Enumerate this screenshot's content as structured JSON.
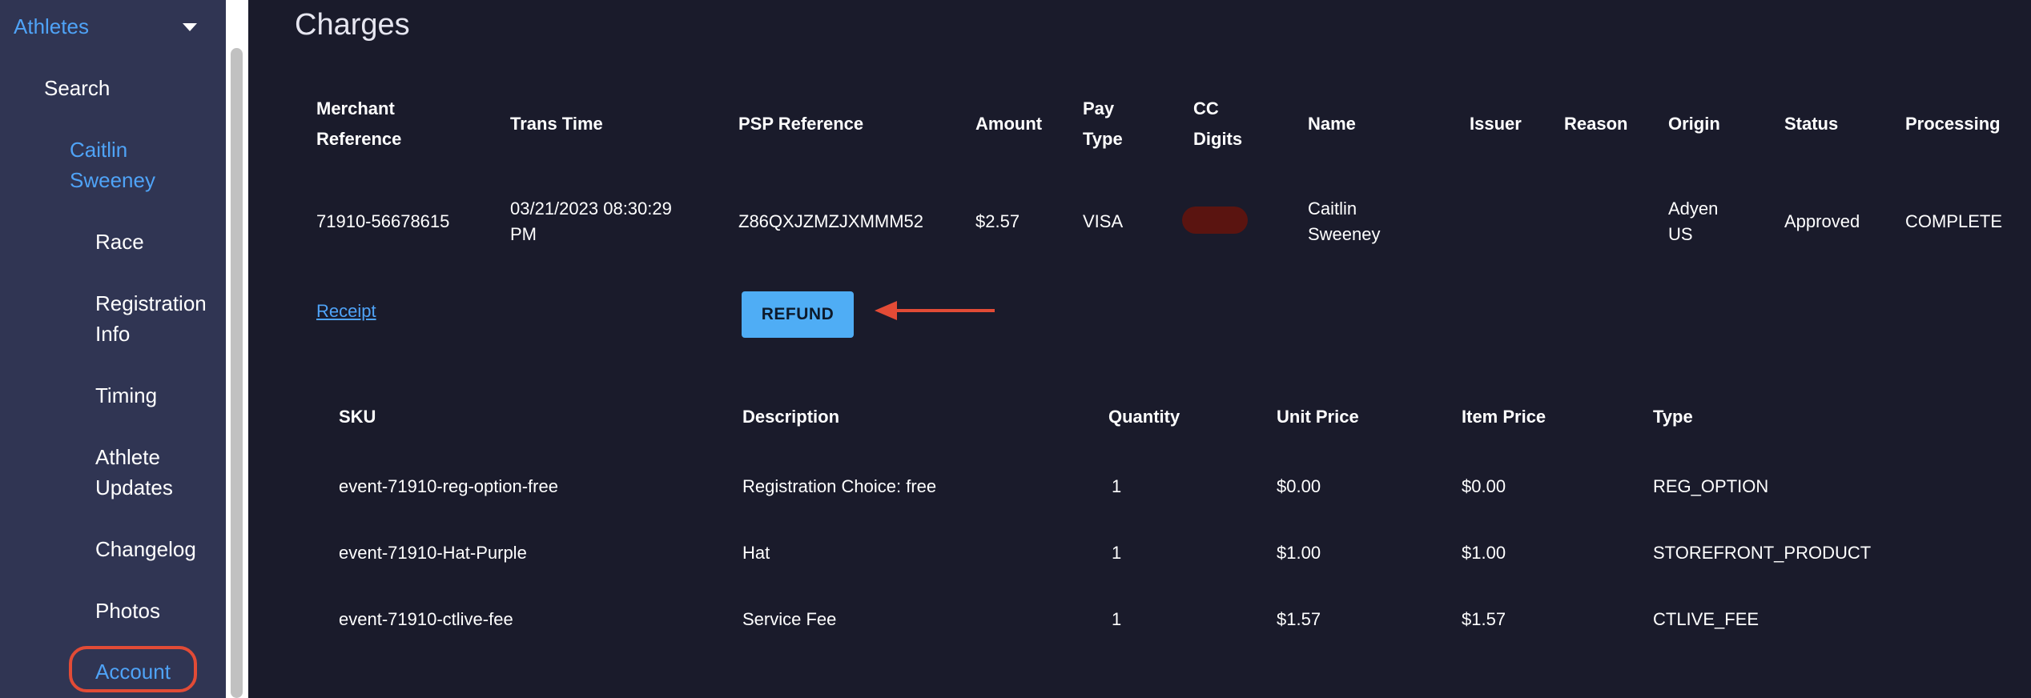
{
  "sidebar": {
    "section_label": "Athletes",
    "items": [
      {
        "label": "Search"
      },
      {
        "label": "Caitlin Sweeney"
      },
      {
        "label": "Race"
      },
      {
        "label": "Registration Info"
      },
      {
        "label": "Timing"
      },
      {
        "label": "Athlete Updates"
      },
      {
        "label": "Changelog"
      },
      {
        "label": "Photos"
      },
      {
        "label": "Account"
      }
    ]
  },
  "page": {
    "title": "Charges"
  },
  "charges": {
    "headers": {
      "merchant_reference": "Merchant Reference",
      "trans_time": "Trans Time",
      "psp_reference": "PSP Reference",
      "amount": "Amount",
      "pay_type": "Pay Type",
      "cc_digits": "CC Digits",
      "name": "Name",
      "issuer": "Issuer",
      "reason": "Reason",
      "origin": "Origin",
      "status": "Status",
      "processing": "Processing"
    },
    "row": {
      "merchant_reference": "71910-56678615",
      "trans_time": "03/21/2023 08:30:29 PM",
      "psp_reference": "Z86QXJZMZJXMMM52",
      "amount": "$2.57",
      "pay_type": "VISA",
      "name": "Caitlin Sweeney",
      "issuer": "",
      "reason": "",
      "origin": "Adyen US",
      "status": "Approved",
      "processing": "COMPLETE"
    },
    "receipt_label": "Receipt",
    "refund_label": "REFUND"
  },
  "items": {
    "headers": {
      "sku": "SKU",
      "description": "Description",
      "quantity": "Quantity",
      "unit_price": "Unit Price",
      "item_price": "Item Price",
      "type": "Type"
    },
    "rows": [
      {
        "sku": "event-71910-reg-option-free",
        "description": "Registration Choice: free",
        "quantity": "1",
        "unit_price": "$0.00",
        "item_price": "$0.00",
        "type": "REG_OPTION"
      },
      {
        "sku": "event-71910-Hat-Purple",
        "description": "Hat",
        "quantity": "1",
        "unit_price": "$1.00",
        "item_price": "$1.00",
        "type": "STOREFRONT_PRODUCT"
      },
      {
        "sku": "event-71910-ctlive-fee",
        "description": "Service Fee",
        "quantity": "1",
        "unit_price": "$1.57",
        "item_price": "$1.57",
        "type": "CTLIVE_FEE"
      }
    ]
  },
  "colors": {
    "background": "#1a1b2b",
    "sidebar": "#303553",
    "link": "#4fa3f7",
    "refund_button": "#4fadf5",
    "highlight_annotation": "#e24b36"
  },
  "icons": {
    "expand": "chevron-down-icon",
    "annotation_arrow": "arrow-left-icon"
  }
}
